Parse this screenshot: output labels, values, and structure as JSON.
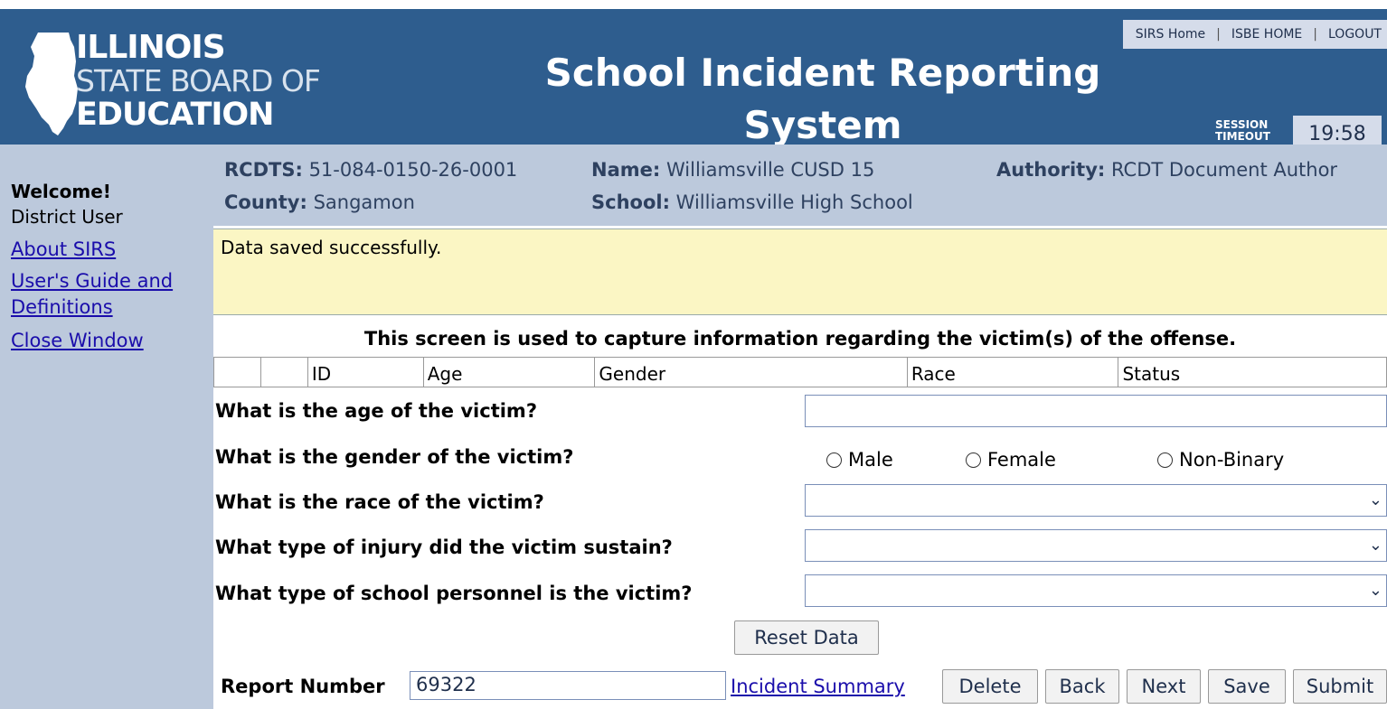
{
  "header": {
    "logo_line1": "ILLINOIS",
    "logo_line2": "STATE BOARD OF",
    "logo_line3": "EDUCATION",
    "title_line1": "School Incident Reporting",
    "title_line2": "System",
    "links": [
      "SIRS Home",
      "ISBE HOME",
      "LOGOUT"
    ],
    "session_label_1": "SESSION",
    "session_label_2": "TIMEOUT",
    "session_timer": "19:58"
  },
  "sidebar": {
    "welcome": "Welcome!",
    "user": "District User",
    "links": [
      "About SIRS",
      "User's Guide and",
      "Definitions",
      "Close Window"
    ]
  },
  "info": {
    "rcdts_label": "RCDTS:",
    "rcdts_value": "51-084-0150-26-0001",
    "name_label": "Name:",
    "name_value": "Williamsville CUSD 15",
    "authority_label": "Authority:",
    "authority_value": "RCDT Document Author",
    "county_label": "County:",
    "county_value": "Sangamon",
    "school_label": "School:",
    "school_value": "Williamsville High School"
  },
  "message": "Data saved successfully.",
  "intro": "This screen is used to capture information regarding the victim(s) of the offense.",
  "grid_columns": [
    "",
    "",
    "ID",
    "Age",
    "Gender",
    "Race",
    "Status"
  ],
  "form": {
    "q_age": "What is the age of the victim?",
    "q_gender": "What is the gender of the victim?",
    "q_race": "What is the race of the victim?",
    "q_injury": "What type of injury did the victim sustain?",
    "q_personnel": "What type of school personnel is the victim?",
    "age_value": "",
    "gender_options": [
      "Male",
      "Female",
      "Non-Binary"
    ],
    "race_value": "",
    "injury_value": "",
    "personnel_value": ""
  },
  "buttons": {
    "reset": "Reset Data",
    "delete": "Delete",
    "back": "Back",
    "next": "Next",
    "save": "Save",
    "submit": "Submit"
  },
  "report": {
    "label": "Report Number",
    "value": "69322",
    "incident_summary": "Incident Summary"
  }
}
